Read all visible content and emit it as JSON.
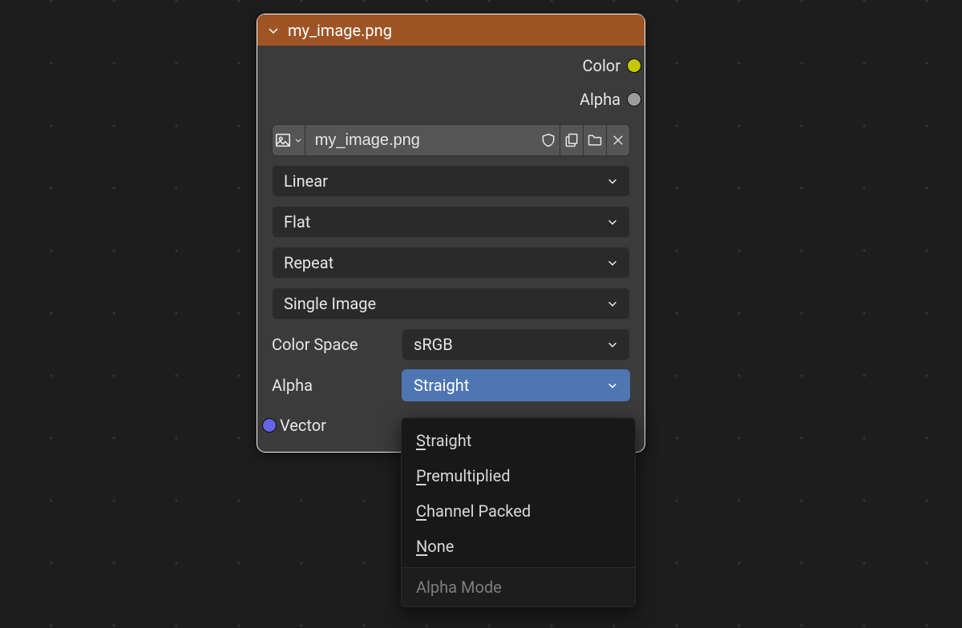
{
  "node": {
    "title": "my_image.png",
    "outputs": {
      "color": "Color",
      "alpha": "Alpha"
    },
    "image_name": "my_image.png",
    "interpolation": "Linear",
    "projection": "Flat",
    "extension": "Repeat",
    "source": "Single Image",
    "color_space": {
      "label": "Color Space",
      "value": "sRGB"
    },
    "alpha_mode": {
      "label": "Alpha",
      "value": "Straight"
    },
    "inputs": {
      "vector": "Vector"
    },
    "icons": {
      "image": "image-icon",
      "shield": "shield-icon",
      "duplicate": "copy-icon",
      "open": "folder-icon",
      "unlink": "close-icon"
    }
  },
  "dropdown": {
    "options": [
      {
        "key": "S",
        "rest": "traight"
      },
      {
        "key": "P",
        "rest": "remultiplied"
      },
      {
        "key": "C",
        "rest": "hannel Packed"
      },
      {
        "key": "N",
        "rest": "one"
      }
    ],
    "footer": "Alpha Mode"
  },
  "colors": {
    "accent": "#4d76b3",
    "header": "#9f5426"
  }
}
